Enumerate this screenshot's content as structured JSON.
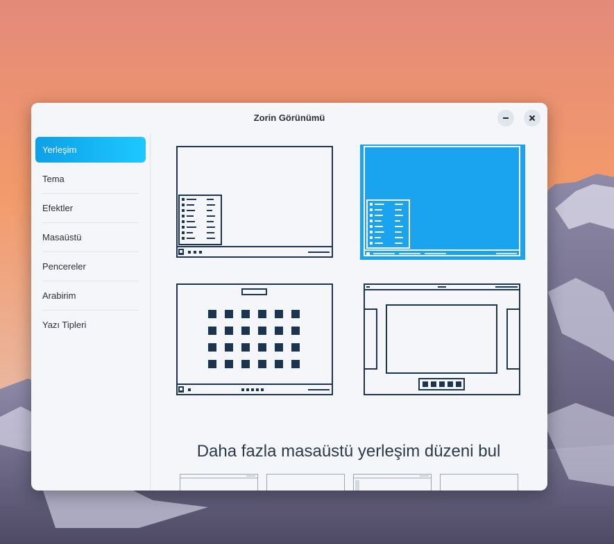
{
  "window": {
    "title": "Zorin Görünümü",
    "minimize_icon": "minimize-icon",
    "close_icon": "close-icon"
  },
  "sidebar": {
    "items": [
      {
        "label": "Yerleşim",
        "active": true
      },
      {
        "label": "Tema",
        "active": false
      },
      {
        "label": "Efektler",
        "active": false
      },
      {
        "label": "Masaüstü",
        "active": false
      },
      {
        "label": "Pencereler",
        "active": false
      },
      {
        "label": "Arabirim",
        "active": false
      },
      {
        "label": "Yazı Tipleri",
        "active": false
      }
    ]
  },
  "main": {
    "layouts": [
      {
        "name": "windows-like",
        "selected": false
      },
      {
        "name": "windows-classic",
        "selected": true
      },
      {
        "name": "app-grid",
        "selected": false
      },
      {
        "name": "gnome-like",
        "selected": false
      }
    ],
    "more_heading": "Daha fazla masaüstü yerleşim düzeni bul",
    "thumbnail_count": 4
  },
  "colors": {
    "accent": "#1aa3ee",
    "outline": "#1b3550",
    "window_bg": "#f4f6fa"
  }
}
